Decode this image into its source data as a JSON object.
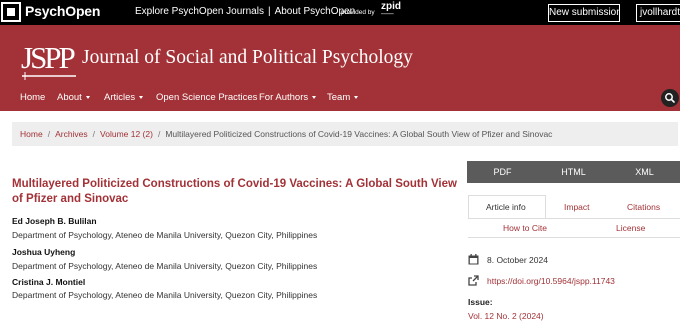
{
  "topbar": {
    "brand": "PsychOpen",
    "links": [
      "Explore PsychOpen Journals",
      "About PsychOpen"
    ],
    "provided_by": "provided by",
    "zpid": "zpid",
    "submit_label": "New submission",
    "user_label": "jvollhardt"
  },
  "header": {
    "logo_text": "JSPP",
    "journal_title": "Journal of Social and Political Psychology",
    "brand_color": "#a23237"
  },
  "nav": {
    "items": [
      {
        "label": "Home",
        "dropdown": false
      },
      {
        "label": "About",
        "dropdown": true
      },
      {
        "label": "Articles",
        "dropdown": true
      },
      {
        "label": "Open Science Practices",
        "dropdown": false
      },
      {
        "label": "For Authors",
        "dropdown": true
      },
      {
        "label": "Team",
        "dropdown": true
      }
    ],
    "search_icon": "search-icon"
  },
  "breadcrumb": {
    "items": [
      "Home",
      "Archives",
      "Volume 12 (2)"
    ],
    "current": "Multilayered Politicized Constructions of Covid-19 Vaccines: A Global South View of Pfizer and Sinovac"
  },
  "article": {
    "title": "Multilayered Politicized Constructions of Covid-19 Vaccines: A Global South View of Pfizer and Sinovac",
    "authors": [
      {
        "name": "Ed Joseph B. Bulilan",
        "affiliation": "Department of Psychology, Ateneo de Manila University, Quezon City, Philippines"
      },
      {
        "name": "Joshua Uyheng",
        "affiliation": "Department of Psychology, Ateneo de Manila University, Quezon City, Philippines"
      },
      {
        "name": "Cristina J. Montiel",
        "affiliation": "Department of Psychology, Ateneo de Manila University, Quezon City, Philippines"
      }
    ]
  },
  "sidebar": {
    "galleys": [
      "PDF",
      "HTML",
      "XML"
    ],
    "tabs_row1": [
      "Article info",
      "Impact",
      "Citations"
    ],
    "tabs_row2": [
      "How to Cite",
      "License"
    ],
    "active_tab": "Article info",
    "date": "8. October 2024",
    "doi": "https://doi.org/10.5964/jspp.11743",
    "issue_label": "Issue:",
    "issue_value": "Vol. 12 No. 2 (2024)"
  }
}
